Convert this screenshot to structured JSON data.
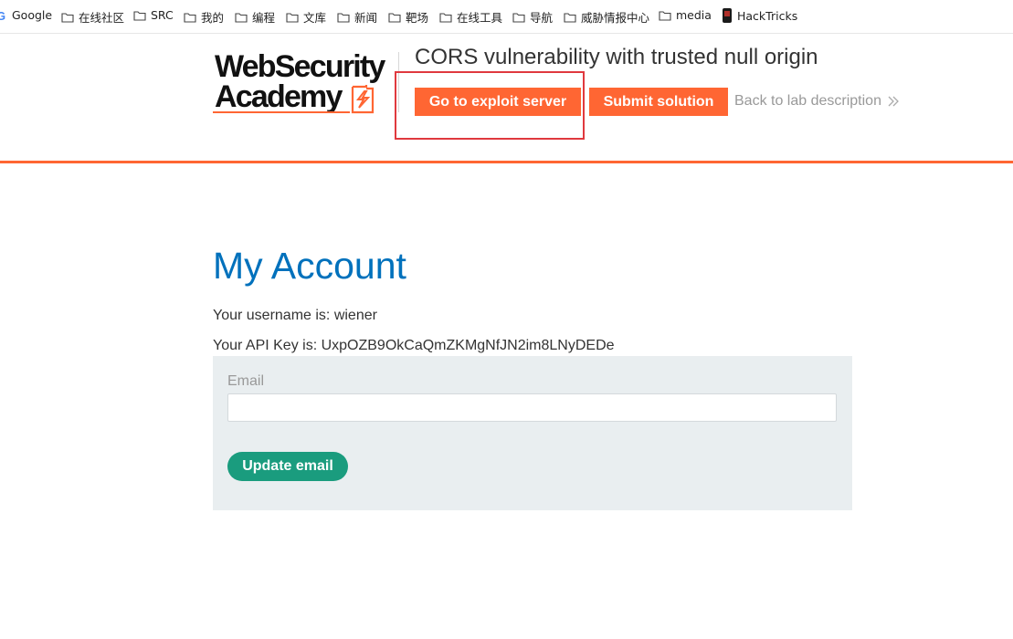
{
  "bookmarks": [
    {
      "label": "Google",
      "icon": "google-icon"
    },
    {
      "label": "在线社区",
      "icon": "folder-icon"
    },
    {
      "label": "SRC",
      "icon": "folder-icon"
    },
    {
      "label": "我的",
      "icon": "folder-icon"
    },
    {
      "label": "编程",
      "icon": "folder-icon"
    },
    {
      "label": "文库",
      "icon": "folder-icon"
    },
    {
      "label": "新闻",
      "icon": "folder-icon"
    },
    {
      "label": "靶场",
      "icon": "folder-icon"
    },
    {
      "label": "在线工具",
      "icon": "folder-icon"
    },
    {
      "label": "导航",
      "icon": "folder-icon"
    },
    {
      "label": "威胁情报中心",
      "icon": "folder-icon"
    },
    {
      "label": "media",
      "icon": "folder-icon"
    },
    {
      "label": "HackTricks",
      "icon": "hacktricks-icon"
    }
  ],
  "header": {
    "logo_line1": "WebSecurity",
    "logo_line2": "Academy",
    "lab_title": "CORS vulnerability with trusted null origin",
    "exploit_button": "Go to exploit server",
    "submit_button": "Submit solution",
    "back_link": "Back to lab description"
  },
  "main": {
    "heading": "My Account",
    "username_line": "Your username is: wiener",
    "api_key_line": "Your API Key is: UxpOZB9OkCaQmZKMgNfJN2im8LNyDEDe",
    "email_label": "Email",
    "email_value": "",
    "update_button": "Update email"
  },
  "colors": {
    "accent_orange": "#ff6633",
    "heading_blue": "#0071bc",
    "button_green": "#1a9c7e",
    "highlight_red": "#e0393e",
    "panel_bg": "#e9eef0"
  }
}
